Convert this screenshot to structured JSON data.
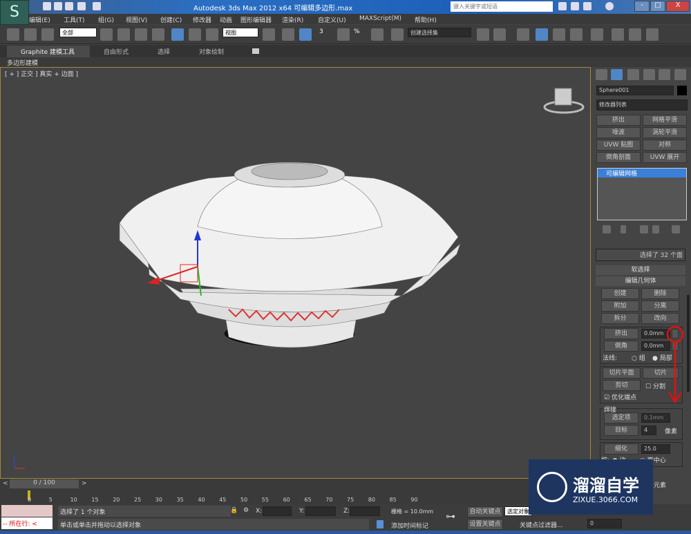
{
  "app": {
    "title": "Autodesk 3ds Max  2012 x64     可编辑多边形.max",
    "search_placeholder": "键入关键字或短语",
    "logo": "S"
  },
  "window_controls": [
    "-",
    "□",
    "X"
  ],
  "menu": [
    "编辑(E)",
    "工具(T)",
    "组(G)",
    "视图(V)",
    "创建(C)",
    "修改器",
    "动画",
    "图形编辑器",
    "渲染(R)",
    "自定义(U)",
    "MAXScript(M)",
    "帮助(H)"
  ],
  "toolbar": {
    "selection_filter": "全部",
    "ref_coord": "视图",
    "named_selection": "创建选择集",
    "snap_labels": [
      "3",
      "%"
    ]
  },
  "ribbon": {
    "tabs": [
      "Graphite 建模工具",
      "自由形式",
      "选择",
      "对象绘制"
    ],
    "subtab": "多边形建模"
  },
  "viewport": {
    "label": "[ + ] 正交 ] 真实 + 边面 ]"
  },
  "command_panel": {
    "object_name": "Sphere001",
    "modifier_list": "修改器列表",
    "modifier_buttons": [
      "挤出",
      "网格平滑",
      "噪波",
      "涡轮平滑",
      "UVW 贴图",
      "对称",
      "倒角剖面",
      "UVW 展开"
    ],
    "stack_item": "可编辑网格",
    "selection_info": "选择了 32 个面",
    "soft_selection": "软选择",
    "edit_geometry": "编辑几何体",
    "geo_buttons": [
      "创建",
      "删除",
      "附加",
      "分离",
      "拆分",
      "改向"
    ],
    "extrude_label": "挤出",
    "extrude_value": "0.0mm",
    "bevel_label": "倒角",
    "bevel_value": "0.0mm",
    "normals_label": "法线:",
    "normal_group": "组",
    "normal_local": "局部",
    "slice_plane": "切片平面",
    "slice": "切片",
    "cut": "剪切",
    "split": "分割",
    "refine_ends": "优化端点",
    "weld": "焊接",
    "selected": "选定项",
    "selected_value": "0.1mm",
    "target": "目标",
    "target_value": "4",
    "pixels": "像素",
    "tessellate": "细化",
    "tess_value": "25.0",
    "by": "按:",
    "edge": "边",
    "face_center": "面中心",
    "element": "元素"
  },
  "timeline": {
    "frame": "0 / 100",
    "ticks": [
      "0",
      "5",
      "10",
      "15",
      "20",
      "25",
      "30",
      "35",
      "40",
      "45",
      "50",
      "55",
      "60",
      "65",
      "70",
      "75",
      "80",
      "85",
      "90"
    ]
  },
  "status": {
    "script_label": "-- 所在行: <",
    "selected": "选择了 1 个对象",
    "prompt": "单击或单击并拖动以选择对象",
    "x_label": "X:",
    "y_label": "Y:",
    "z_label": "Z:",
    "grid": "栅格 = 10.0mm",
    "add_time_tag": "添加时间标记",
    "auto_key": "自动关键点",
    "selected_obj": "选定对象",
    "set_key": "设置关键点",
    "key_filters": "关键点过滤器...",
    "frame_value": "0"
  },
  "watermark": {
    "name": "溜溜自学",
    "url": "ZIXUE.3066.COM"
  },
  "colors": {
    "accent": "#4f86c6",
    "annotation": "#e01010"
  }
}
